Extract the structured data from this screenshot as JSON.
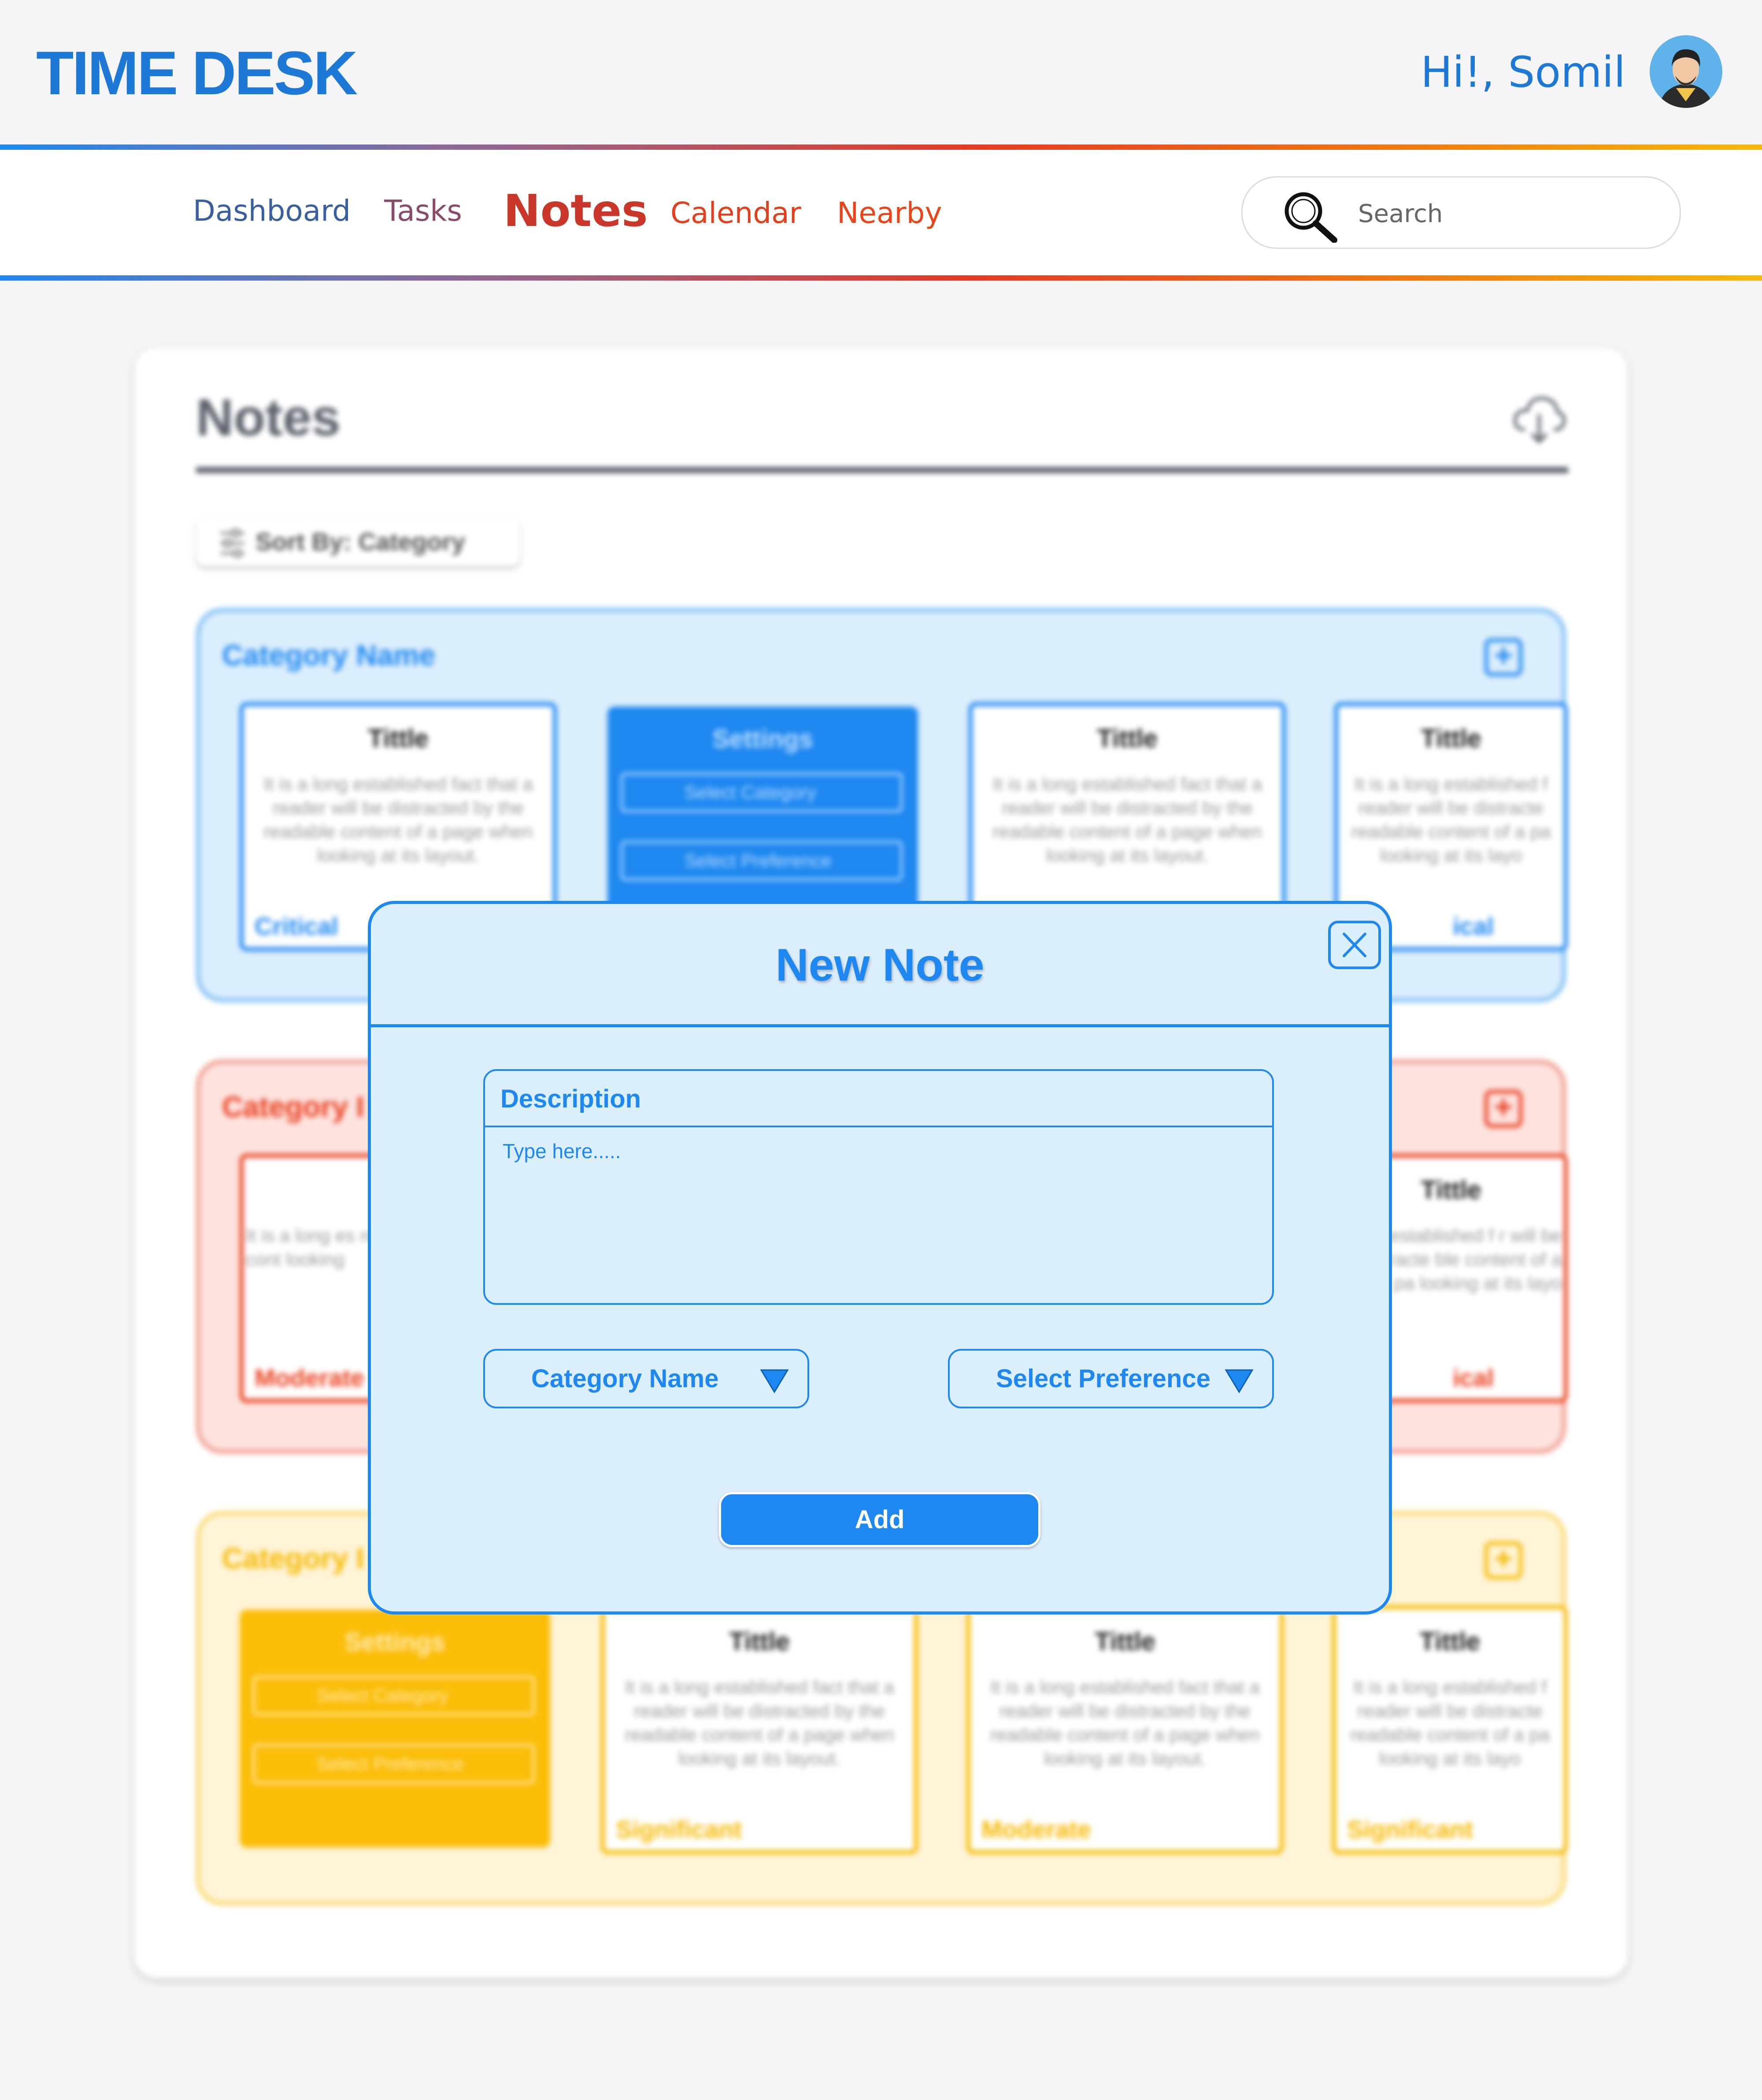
{
  "app": {
    "title": "TIME DESK",
    "greeting": "Hi!, Somil"
  },
  "nav": {
    "items": [
      {
        "label": "Dashboard",
        "color": "#3a5fa0"
      },
      {
        "label": "Tasks",
        "color": "#8a4a6a"
      },
      {
        "label": "Notes",
        "color": "#c8372a",
        "active": true
      },
      {
        "label": "Calendar",
        "color": "#e0401e"
      },
      {
        "label": "Nearby",
        "color": "#e8461a"
      }
    ],
    "search_placeholder": "Search"
  },
  "page": {
    "title": "Notes",
    "sort_label": "Sort By: Category"
  },
  "groups": [
    {
      "name": "Category Name",
      "color": "#1e88f0",
      "cards": [
        {
          "type": "note",
          "title": "Tittle",
          "body": "It is a long established fact that a reader will be distracted by the readable content of a page when looking at its layout.",
          "level": "Critical"
        },
        {
          "type": "settings",
          "title": "Settings",
          "select_category": "Select Category",
          "select_preference": "Select Preference"
        },
        {
          "type": "note",
          "title": "Tittle",
          "body": "It is a long established fact that a reader will be distracted by the readable content of a page when looking at its layout.",
          "level": ""
        },
        {
          "type": "note",
          "title": "Tittle",
          "body": "It is a long established f reader will be distracte readable content of a pa looking at its layo",
          "level": "ical"
        }
      ]
    },
    {
      "name": "Category I",
      "color": "#e8401e",
      "cards": [
        {
          "type": "note",
          "title": "",
          "body": "It is a long es reader will b readable cont looking",
          "level": "Moderate"
        },
        {
          "type": "note",
          "title": "Tittle",
          "body": "long established f r will be distracte ble content of a pa looking at its layo",
          "level": "ical"
        }
      ]
    },
    {
      "name": "Category I",
      "color": "#f5b800",
      "cards": [
        {
          "type": "settings",
          "title": "Settings",
          "select_category": "Select Category",
          "select_preference": "Select Preference"
        },
        {
          "type": "note",
          "title": "Tittle",
          "body": "It is a long established fact that a reader will be distracted by the readable content of a page when looking at its layout.",
          "level": "Significant"
        },
        {
          "type": "note",
          "title": "Tittle",
          "body": "It is a long established fact that a reader will be distracted by the readable content of a page when looking at its layout.",
          "level": "Moderate"
        },
        {
          "type": "note",
          "title": "Tittle",
          "body": "It is a long established f reader will be distracte readable content of a pa looking at its layo",
          "level": "Significant"
        }
      ]
    }
  ],
  "modal": {
    "title": "New Note",
    "description_label": "Description",
    "description_placeholder": "Type here.....",
    "category_dropdown": "Category Name",
    "preference_dropdown": "Select Preference",
    "add_label": "Add"
  }
}
